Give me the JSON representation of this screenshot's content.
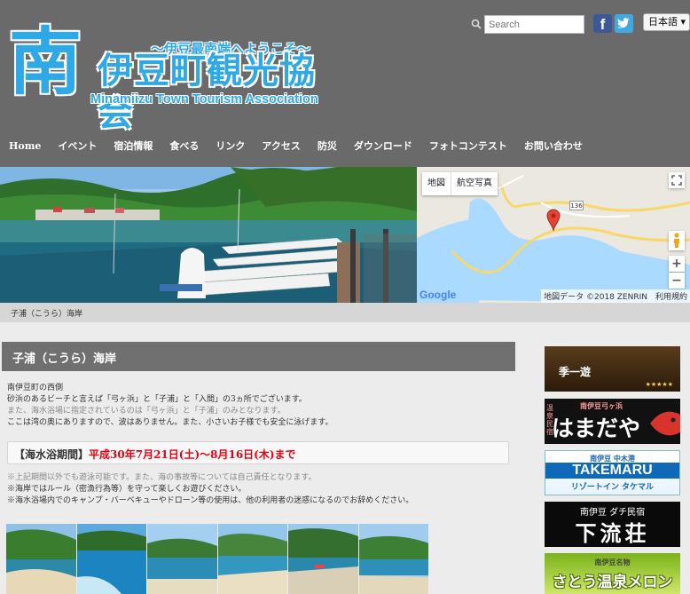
{
  "logo": {
    "kanji_big": "南",
    "kanji_rest": "伊豆町観光協会",
    "tagline": "〜伊豆最南端へようこそ〜",
    "english": "Minamiizu Town Tourism Association"
  },
  "search": {
    "placeholder": "Search"
  },
  "social": {
    "facebook_glyph": "f"
  },
  "language": {
    "selected": "日本語 ▾"
  },
  "nav": {
    "items": [
      "Home",
      "イベント",
      "宿泊情報",
      "食べる",
      "リンク",
      "アクセス",
      "防災",
      "ダウンロード",
      "フォトコンテスト",
      "お問い合わせ"
    ]
  },
  "map": {
    "btn_map": "地図",
    "btn_satellite": "航空写真",
    "google": "Google",
    "credit": "地図データ ©2018 ZENRIN　利用規約",
    "road_number": "136",
    "zoom_in": "+",
    "zoom_out": "−"
  },
  "photo_caption": "子浦（こうら）海岸",
  "main": {
    "title": "子浦（こうら）海岸",
    "intro": [
      "南伊豆町の西側",
      "砂浜のあるビーチと言えば「弓ヶ浜」と「子浦」と「入間」の3ヵ所でございます。",
      "また、海水浴場に指定されているのは「弓ヶ浜」と「子浦」のみとなります。",
      "ここは湾の奥にありますので、波はありません。また、小さいお子様でも安全に泳げます。"
    ],
    "season_label": "【海水浴期間】",
    "season_dates": "平成30年7月21日(土)〜8月16日(木)まで",
    "notes": [
      "※上記期間以外でも遊泳可能です。また、海の事故等については自己責任となります。",
      "※海岸ではルール（密漁行為等）を守って楽しくお遊びください。",
      "※海水浴場内でのキャンプ・バーベキューやドローン等の使用は、他の利用者の迷惑になるのでお辞めください。"
    ]
  },
  "ads": {
    "ad1": {
      "text": "季一遊",
      "stars": "★★★★★"
    },
    "ad2": {
      "sub": "南伊豆弓ヶ浜",
      "main": "はまだや",
      "side": "温泉民宿"
    },
    "ad3": {
      "sub": "南伊豆 中木港",
      "main": "TAKEMARU",
      "bottom": "リゾートイン タケマル"
    },
    "ad4": {
      "sub": "南伊豆 ダチ民宿",
      "main": "下流荘"
    },
    "ad5": {
      "sub": "南伊豆名物",
      "main": "さとう温泉メロン"
    }
  },
  "colors": {
    "header_bg": "#6a6a6a",
    "logo_blue": "#2fa8e6",
    "title_bar": "#707070",
    "season_red": "#e60012",
    "page_bg": "#ececec"
  }
}
